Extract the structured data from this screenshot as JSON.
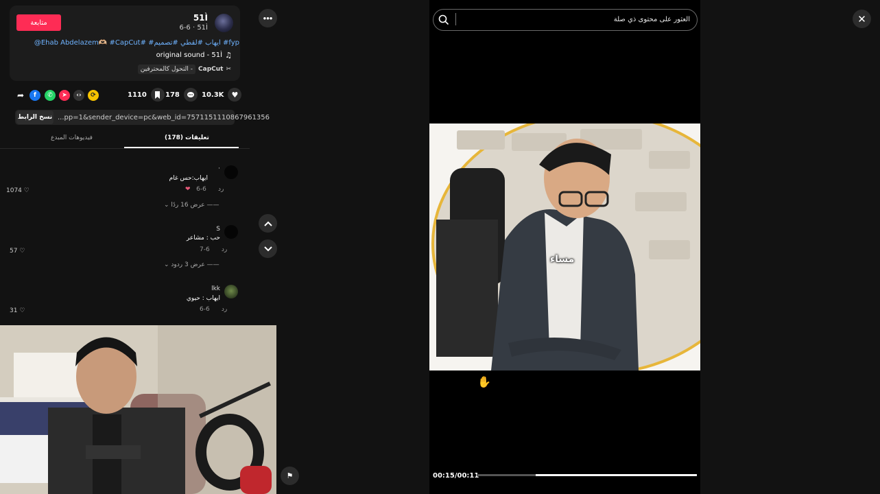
{
  "author": {
    "username": "51Ì",
    "subline": "6-6 · 51Ì",
    "follow_label": "متابعة"
  },
  "post": {
    "description": "@Ehab Abdelazem🫶🏼 #CapCut# #ايهاب #لقطي #تصميم #fyp",
    "sound": "original sound - 51Ì",
    "capcut_name": "CapCut",
    "capcut_tag": "التحول كالمحترفين -"
  },
  "actions": {
    "likes": "10.3K",
    "comments": "178",
    "saves": "1110"
  },
  "share": {
    "link": "...pp=1&sender_device=pc&web_id=7571151110867961356",
    "copy_label": "نسخ الرابط"
  },
  "tabs": {
    "comments": "(178) تعليقات",
    "creator_videos": "فيديوهات المبدع"
  },
  "comments": [
    {
      "name": "·",
      "text": "ايهاب:حس غام",
      "date": "6-6",
      "reply": "رد",
      "likes": "1074",
      "more": "عرض 16 ردًا"
    },
    {
      "name": "S",
      "text": "حب : مشاعر",
      "date": "6-7",
      "reply": "رد",
      "likes": "57",
      "more": "عرض 3 ردود"
    },
    {
      "name": "lkk",
      "text": "ايهاب : حيوي",
      "date": "6-6",
      "reply": "رد",
      "likes": "31"
    }
  ],
  "search": {
    "placeholder": "العثور على محتوى ذي صلة"
  },
  "video": {
    "caption": "مساء",
    "time": "00:15/00:11",
    "progress": 0.27
  },
  "icons": [
    "more-icon",
    "chevron-up-icon",
    "chevron-down-icon",
    "close-icon",
    "search-icon",
    "heart-icon",
    "comment-icon",
    "bookmark-icon",
    "share-arrow-icon",
    "music-note-icon"
  ]
}
